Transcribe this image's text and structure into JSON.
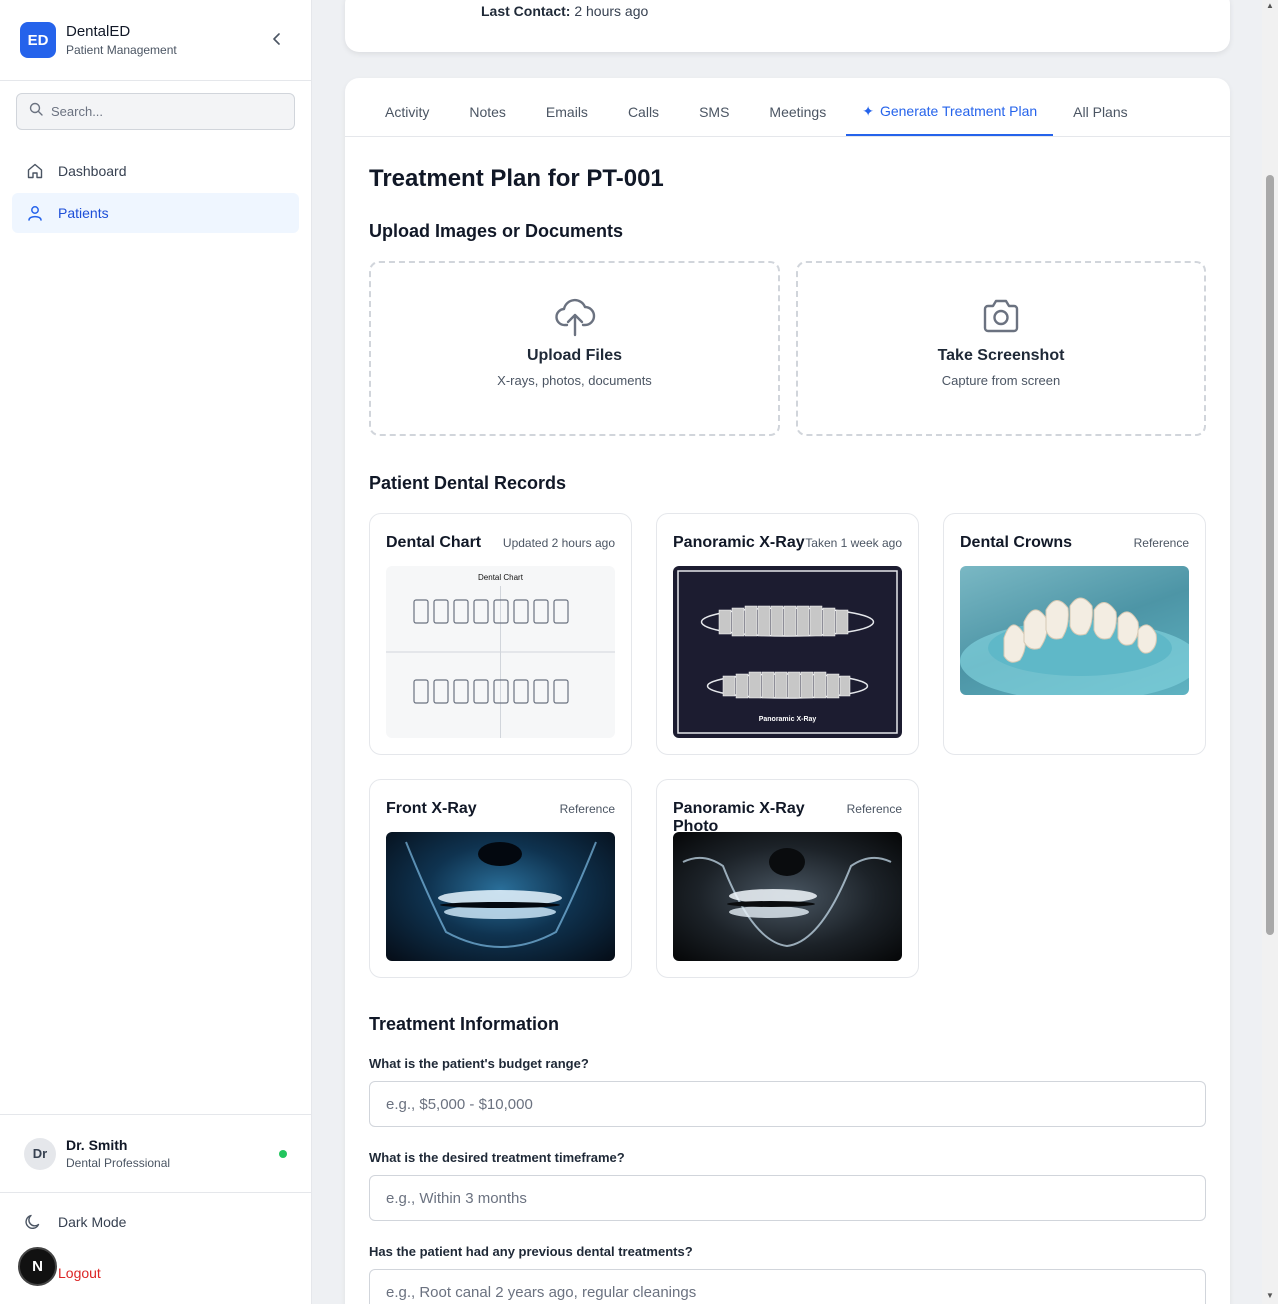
{
  "brand": {
    "logo": "ED",
    "name": "DentalED",
    "subtitle": "Patient Management"
  },
  "search": {
    "placeholder": "Search..."
  },
  "nav": [
    {
      "label": "Dashboard",
      "icon": "home-icon",
      "active": false
    },
    {
      "label": "Patients",
      "icon": "user-icon",
      "active": true
    }
  ],
  "user": {
    "initials": "Dr",
    "name": "Dr. Smith",
    "role": "Dental Professional",
    "status": "online"
  },
  "sidebar_footer": {
    "dark_mode": "Dark Mode",
    "logout": "Logout",
    "badge": "N"
  },
  "contact": {
    "label": "Last Contact:",
    "value": "2 hours ago"
  },
  "tabs": [
    {
      "label": "Activity"
    },
    {
      "label": "Notes"
    },
    {
      "label": "Emails"
    },
    {
      "label": "Calls"
    },
    {
      "label": "SMS"
    },
    {
      "label": "Meetings"
    },
    {
      "label": "Generate Treatment Plan",
      "active": true
    },
    {
      "label": "All Plans"
    }
  ],
  "plan": {
    "title": "Treatment Plan for PT-001",
    "upload_heading": "Upload Images or Documents",
    "upload_files": {
      "title": "Upload Files",
      "subtitle": "X-rays, photos, documents"
    },
    "screenshot": {
      "title": "Take Screenshot",
      "subtitle": "Capture from screen"
    },
    "records_heading": "Patient Dental Records",
    "records": [
      {
        "title": "Dental Chart",
        "meta": "Updated 2 hours ago",
        "image_label": "Dental Chart"
      },
      {
        "title": "Panoramic X-Ray",
        "meta": "Taken 1 week ago",
        "image_label": "Panoramic X-Ray"
      },
      {
        "title": "Dental Crowns",
        "meta": "Reference"
      },
      {
        "title": "Front X-Ray",
        "meta": "Reference"
      },
      {
        "title": "Panoramic X-Ray Photo",
        "meta": "Reference"
      }
    ],
    "info_heading": "Treatment Information",
    "fields": [
      {
        "label": "What is the patient's budget range?",
        "placeholder": "e.g., $5,000 - $10,000"
      },
      {
        "label": "What is the desired treatment timeframe?",
        "placeholder": "e.g., Within 3 months"
      },
      {
        "label": "Has the patient had any previous dental treatments?",
        "placeholder": "e.g., Root canal 2 years ago, regular cleanings"
      }
    ]
  },
  "colors": {
    "accent": "#2563eb",
    "logout": "#dc2626",
    "online": "#22c55e"
  }
}
